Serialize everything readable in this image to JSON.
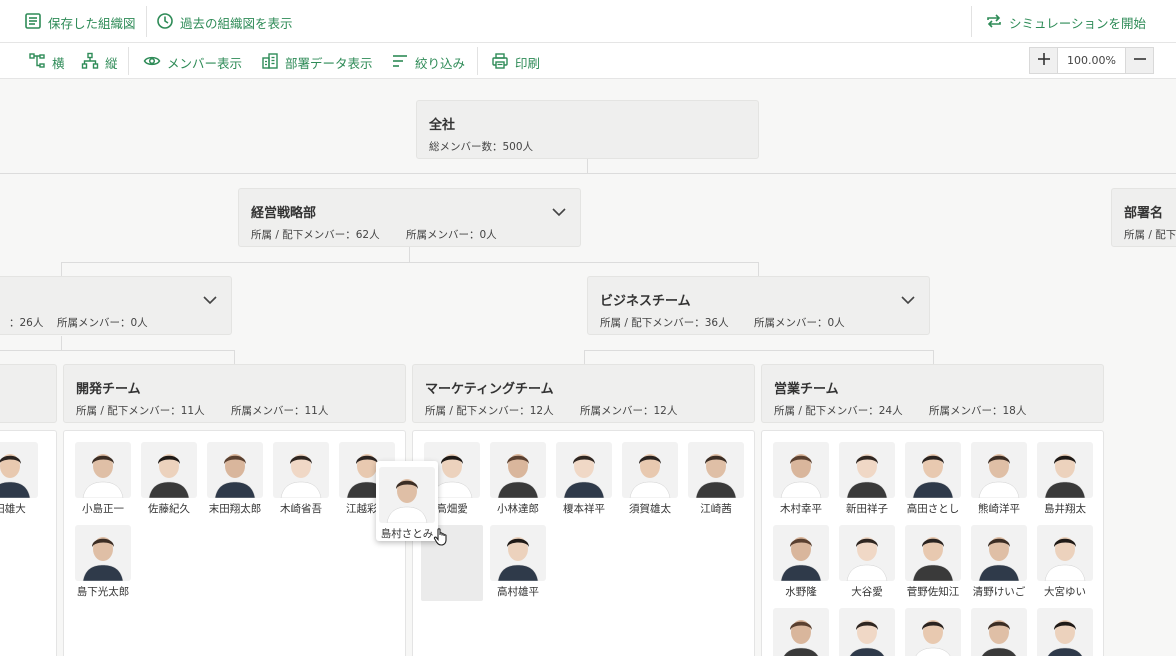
{
  "topbar": {
    "saved_chart": "保存した組織図",
    "past_chart": "過去の組織図を表示",
    "simulation": "シミュレーションを開始"
  },
  "toolbar": {
    "horizontal": "横",
    "vertical": "縦",
    "show_members": "メンバー表示",
    "show_dept_data": "部署データ表示",
    "filter": "絞り込み",
    "print": "印刷",
    "zoom_value": "100.00%"
  },
  "org": {
    "root": {
      "name": "全社",
      "total": "総メンバー数：500人"
    },
    "strategy": {
      "name": "経営戦略部",
      "sub": "所属 / 配下メンバー：62人",
      "direct": "所属メンバー：0人"
    },
    "dept_right": {
      "name": "部署名",
      "sub": "所属 / 配下"
    },
    "left_team": {
      "sub": "：26人",
      "direct": "所属メンバー：0人"
    },
    "business": {
      "name": "ビジネスチーム",
      "sub": "所属 / 配下メンバー：36人",
      "direct": "所属メンバー：0人"
    },
    "dev": {
      "name": "開発チーム",
      "sub": "所属 / 配下メンバー：11人",
      "direct": "所属メンバー：11人"
    },
    "marketing": {
      "name": "マーケティングチーム",
      "sub": "所属 / 配下メンバー：12人",
      "direct": "所属メンバー：12人"
    },
    "sales": {
      "name": "営業チーム",
      "sub": "所属 / 配下メンバー：24人",
      "direct": "所属メンバー：18人"
    }
  },
  "members": {
    "left": [
      "田雄大"
    ],
    "dev": [
      "小島正一",
      "佐藤紀久",
      "末田翔太郎",
      "木崎省吾",
      "江越彩花",
      "島下光太郎"
    ],
    "marketing": [
      "高畑愛",
      "小林達郎",
      "榎本祥平",
      "須賀雄太",
      "江崎茜",
      "高村雄平"
    ],
    "sales": [
      "木村幸平",
      "新田祥子",
      "高田さとし",
      "熊崎洋平",
      "島井翔太",
      "水野隆",
      "大谷愛",
      "菅野佐知江",
      "清野けいご",
      "大宮ゆい"
    ],
    "dragging": "島村さとみ"
  },
  "colors": {
    "accent": "#2e8b57",
    "node_bg": "#efefee",
    "canvas_bg": "#f7f7f6"
  }
}
